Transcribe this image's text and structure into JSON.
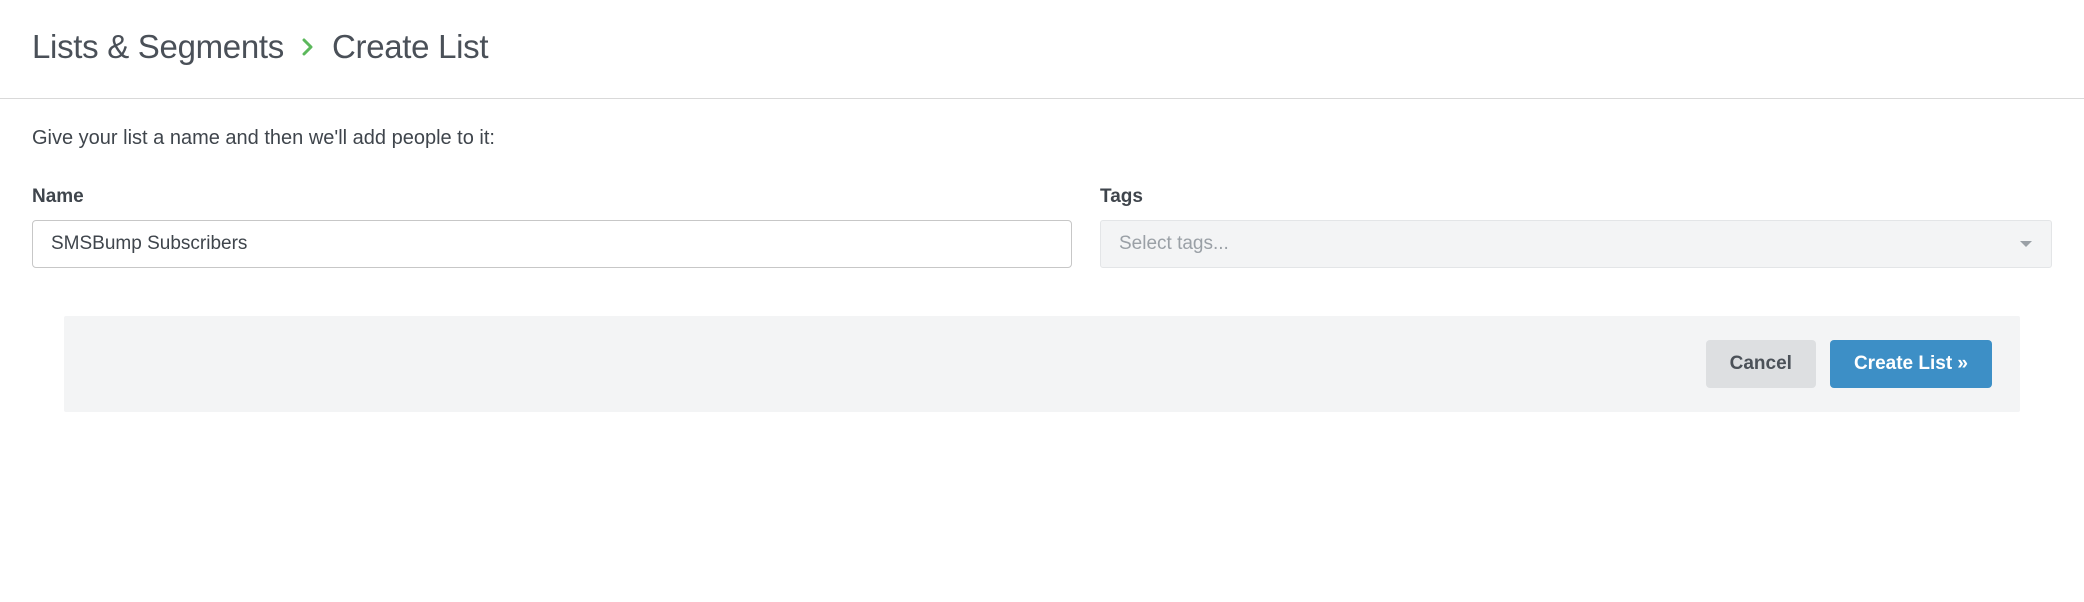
{
  "breadcrumb": {
    "parent": "Lists & Segments",
    "current": "Create List"
  },
  "intro": "Give your list a name and then we'll add people to it:",
  "form": {
    "name_label": "Name",
    "name_value": "SMSBump Subscribers",
    "tags_label": "Tags",
    "tags_placeholder": "Select tags..."
  },
  "actions": {
    "cancel": "Cancel",
    "submit": "Create List »"
  }
}
